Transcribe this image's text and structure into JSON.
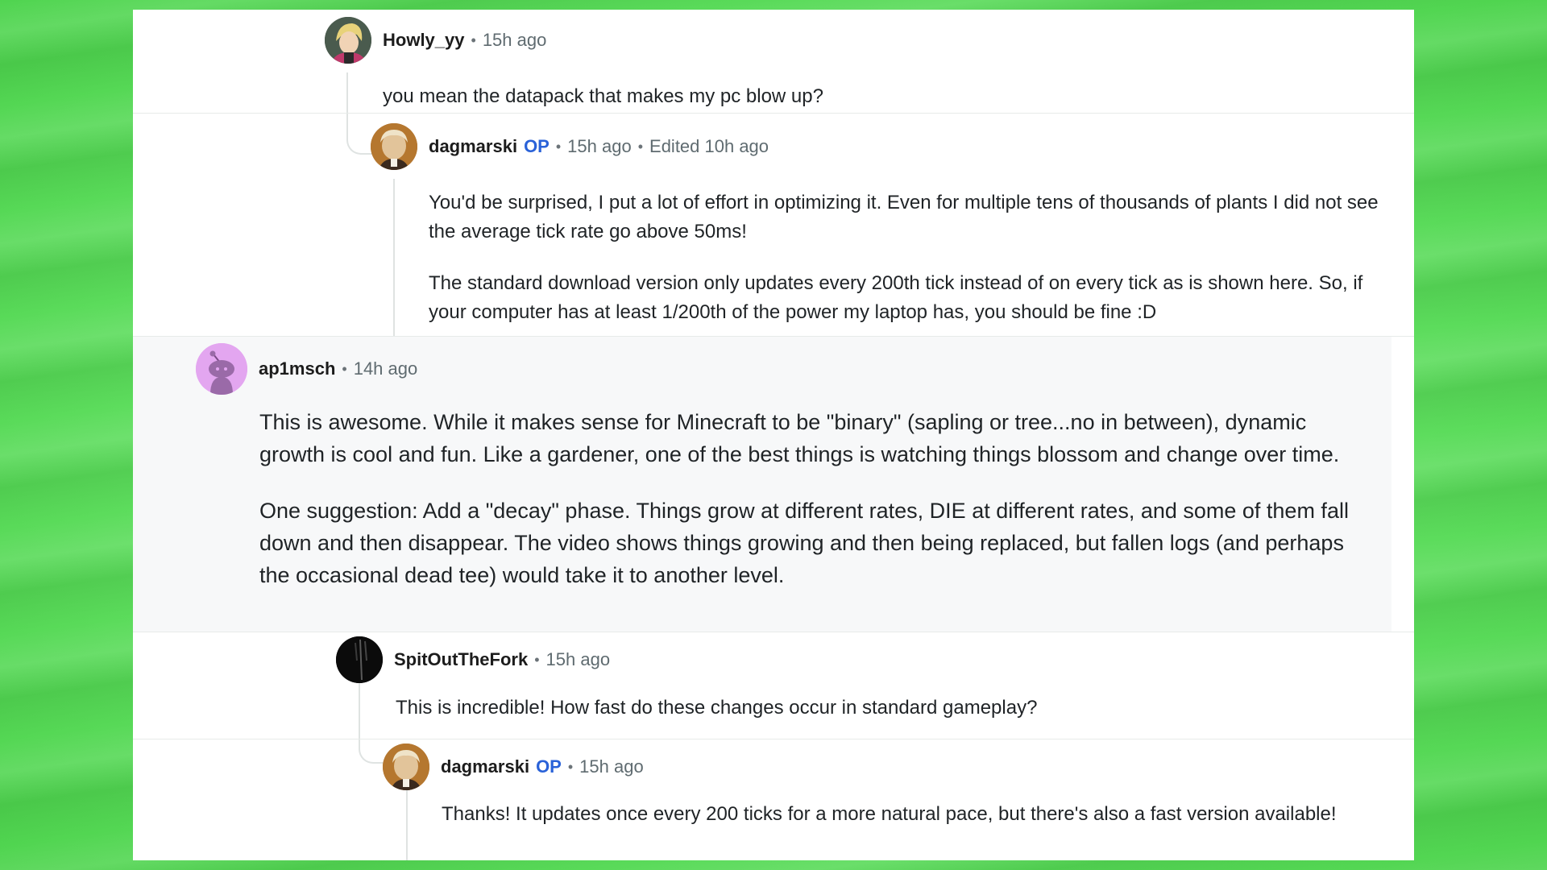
{
  "comments": [
    {
      "username": "Howly_yy",
      "op": "",
      "time": "15h ago",
      "edited": "",
      "paragraphs": [
        "you mean the datapack that makes my pc blow up?"
      ],
      "avatar": "anime-character-avatar"
    },
    {
      "username": "dagmarski",
      "op": "OP",
      "time": "15h ago",
      "edited": "Edited 10h ago",
      "paragraphs": [
        "You'd be surprised, I put a lot of effort in optimizing it. Even for multiple tens of thousands of plants I did not see the average tick rate go above 50ms!",
        "The standard download version only updates every 200th tick instead of on every tick as is shown here. So, if your computer has at least 1/200th of the power my laptop has, you should be fine :D"
      ],
      "avatar": "portrait-avatar"
    },
    {
      "username": "ap1msch",
      "op": "",
      "time": "14h ago",
      "edited": "",
      "paragraphs": [
        "This is awesome. While it makes sense for Minecraft to be \"binary\" (sapling or tree...no in between), dynamic growth is cool and fun. Like a gardener, one of the best things is watching things blossom and change over time.",
        "One suggestion: Add a \"decay\" phase. Things grow at different rates, DIE at different rates, and some of them fall down and then disappear. The video shows things growing and then being replaced, but fallen logs (and perhaps the occasional dead tee) would take it to another level."
      ],
      "avatar": "snoo-avatar"
    },
    {
      "username": "SpitOutTheFork",
      "op": "",
      "time": "15h ago",
      "edited": "",
      "paragraphs": [
        "This is incredible! How fast do these changes occur in standard gameplay?"
      ],
      "avatar": "fork-avatar"
    },
    {
      "username": "dagmarski",
      "op": "OP",
      "time": "15h ago",
      "edited": "",
      "paragraphs": [
        "Thanks! It updates once every 200 ticks for a more natural pace, but there's also a fast version available!"
      ],
      "avatar": "portrait-avatar"
    }
  ],
  "separator": "•",
  "colors": {
    "background_green": "#5fdd5f",
    "op_blue": "#2a62d8",
    "meta_gray": "#5f6b70",
    "thread_line": "#dfe3e2"
  }
}
